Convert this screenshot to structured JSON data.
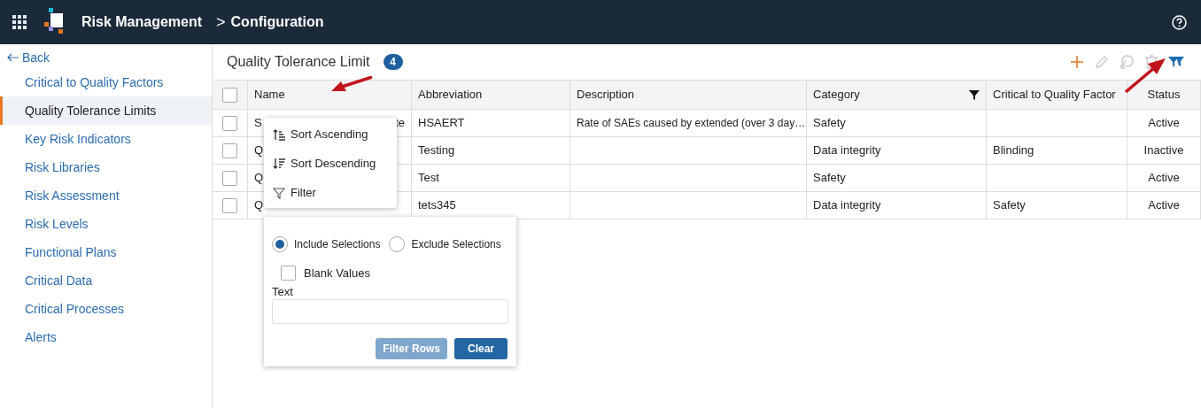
{
  "header": {
    "app": "Risk Management",
    "separator": ">",
    "page": "Configuration"
  },
  "sidebar": {
    "back": "Back",
    "items": [
      {
        "label": "Critical to Quality Factors",
        "selected": false
      },
      {
        "label": "Quality Tolerance Limits",
        "selected": true
      },
      {
        "label": "Key Risk Indicators",
        "selected": false
      },
      {
        "label": "Risk Libraries",
        "selected": false
      },
      {
        "label": "Risk Assessment",
        "selected": false
      },
      {
        "label": "Risk Levels",
        "selected": false
      },
      {
        "label": "Functional Plans",
        "selected": false
      },
      {
        "label": "Critical Data",
        "selected": false
      },
      {
        "label": "Critical Processes",
        "selected": false
      },
      {
        "label": "Alerts",
        "selected": false
      }
    ]
  },
  "panel": {
    "title": "Quality Tolerance Limit",
    "count": "4"
  },
  "toolbar": [
    {
      "kind": "add",
      "disabled": false
    },
    {
      "kind": "edit",
      "disabled": true
    },
    {
      "kind": "restore",
      "disabled": true
    },
    {
      "kind": "delete",
      "disabled": true
    },
    {
      "kind": "filter",
      "disabled": false
    }
  ],
  "table": {
    "select_all_checked": false,
    "columns": [
      {
        "label": "Name",
        "filtered": false
      },
      {
        "label": "Abbreviation",
        "filtered": false
      },
      {
        "label": "Description",
        "filtered": false
      },
      {
        "label": "Category",
        "filtered": true
      },
      {
        "label": "Critical to Quality Factor",
        "filtered": false
      },
      {
        "label": "Status",
        "filtered": false
      }
    ],
    "rows": [
      {
        "checked": false,
        "name_start": "S",
        "name_end": "te",
        "abbreviation": "HSAERT",
        "description": "Rate of SAEs caused by extended (over 3 day…",
        "category": "Safety",
        "factor": "",
        "status": "Active"
      },
      {
        "checked": false,
        "name_start": "Q",
        "name_end": "",
        "abbreviation": "Testing",
        "description": "",
        "category": "Data integrity",
        "factor": "Blinding",
        "status": "Inactive"
      },
      {
        "checked": false,
        "name_start": "Q",
        "name_end": "",
        "abbreviation": "Test",
        "description": "",
        "category": "Safety",
        "factor": "",
        "status": "Active"
      },
      {
        "checked": false,
        "name_start": "Q",
        "name_end": "",
        "abbreviation": "tets345",
        "description": "",
        "category": "Data integrity",
        "factor": "Safety",
        "status": "Active"
      }
    ]
  },
  "column_menu": [
    {
      "kind": "asc",
      "label": "Sort Ascending"
    },
    {
      "kind": "desc",
      "label": "Sort Descending"
    },
    {
      "kind": "filter",
      "label": "Filter"
    }
  ],
  "filter_panel": {
    "options": [
      {
        "label": "Include Selections",
        "selected": true
      },
      {
        "label": "Exclude Selections",
        "selected": false
      }
    ],
    "blank_values": {
      "label": "Blank Values",
      "checked": false
    },
    "text_label": "Text",
    "buttons": [
      {
        "label": "Filter Rows",
        "disabled": true
      },
      {
        "label": "Clear",
        "disabled": false
      }
    ]
  }
}
